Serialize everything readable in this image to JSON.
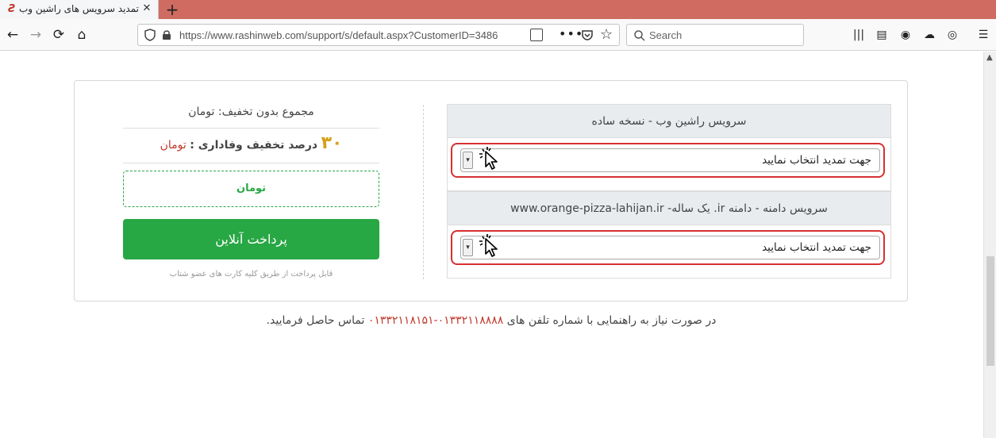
{
  "tab": {
    "title": "تمدید سرویس های راشین وب",
    "close": "✕",
    "new": "+"
  },
  "nav": {
    "back": "←",
    "forward": "→",
    "reload": "⟳",
    "home": "⌂",
    "url": "https://www.rashinweb.com/support/s/default.aspx?CustomerID=3486",
    "more": "•••",
    "star": "☆",
    "search_placeholder": "Search",
    "menu": "☰"
  },
  "colors": {
    "accent_green": "#28a745",
    "highlight_red": "#d63031",
    "price_red": "#c0392b",
    "discount_gold": "#d4a017"
  },
  "services": [
    {
      "title": "سرویس راشین وب - نسخه ساده",
      "select_value": "جهت تمدید انتخاب نمایید"
    },
    {
      "title": "سرویس دامنه - دامنه ir. یک ساله- www.orange-pizza-lahijan.ir",
      "select_value": "جهت تمدید انتخاب نمایید"
    }
  ],
  "summary": {
    "subtotal_label": "مجموع بدون تخفیف:",
    "subtotal_currency": "تومان",
    "discount_value": "۳۰",
    "discount_label": "درصد تخفیف وفاداری :",
    "discount_currency": "تومان",
    "total_currency": "تومان",
    "pay_button": "پرداخت آنلاین",
    "pay_note": "قابل پرداخت از طریق کلیه کارت های عضو شتاب"
  },
  "help": {
    "before": "در صورت نیاز به راهنمایی با شماره تلفن های",
    "phones": "۰۱۳۳۲۱۱۸۸۸۸-۰۱۳۳۲۱۱۸۱۵۱",
    "after": "تماس حاصل فرمایید."
  }
}
